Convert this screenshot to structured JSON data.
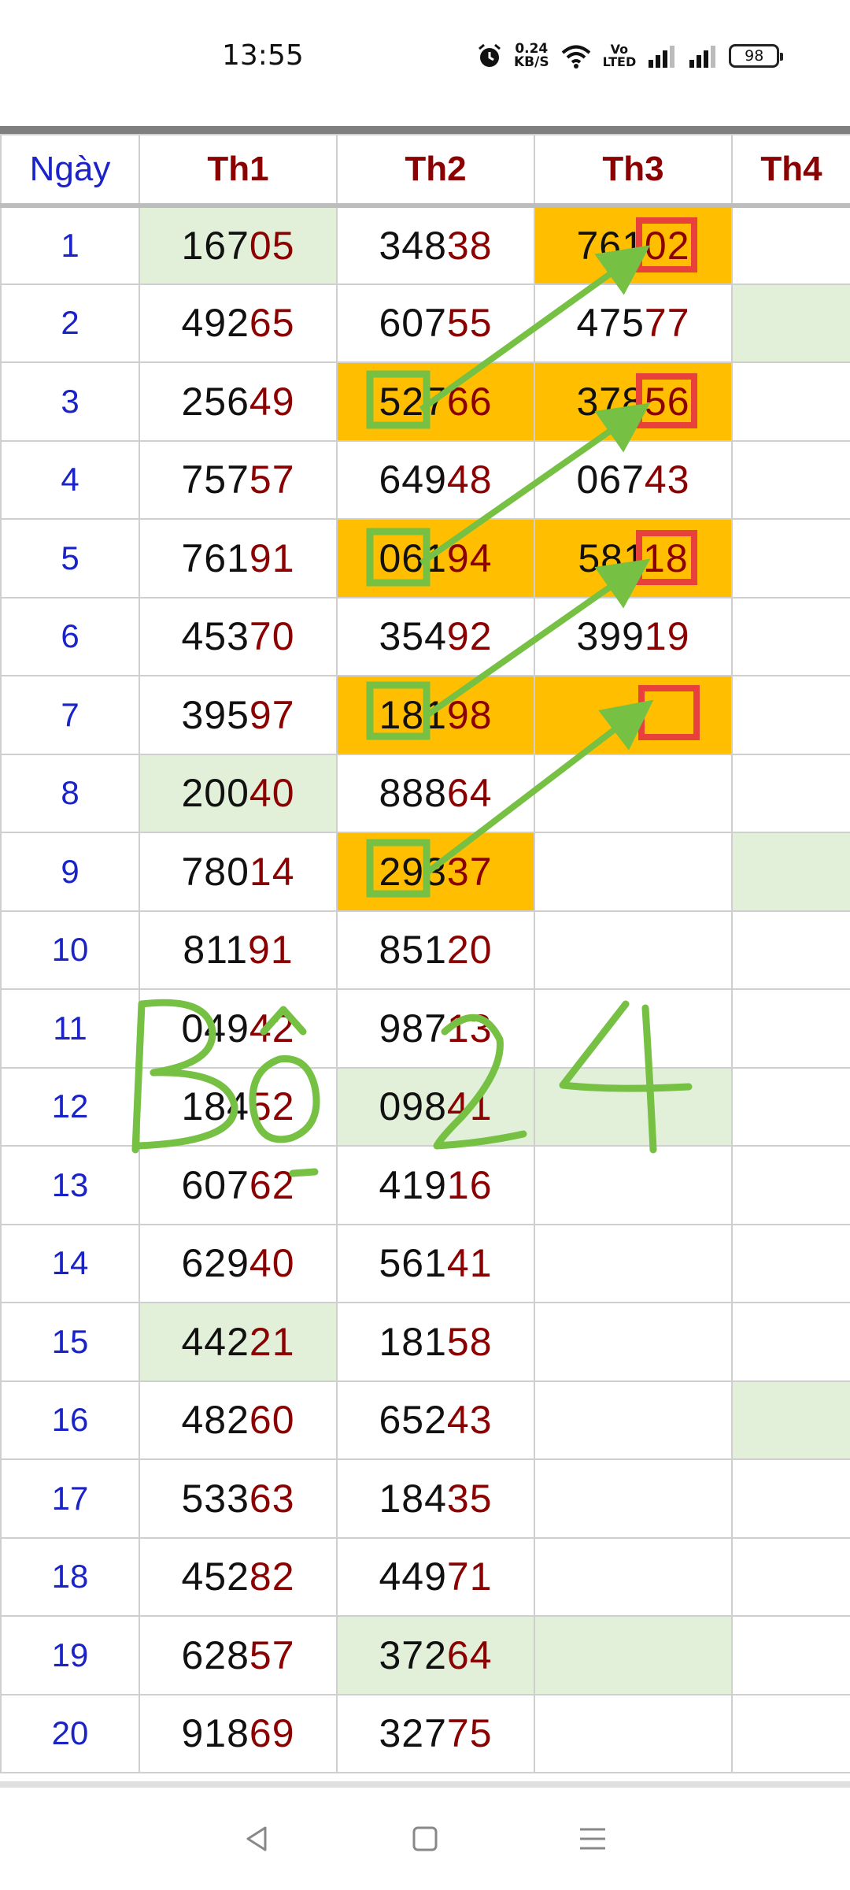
{
  "status_bar": {
    "time": "13:55",
    "speed_value": "0.24",
    "speed_unit": "KB/S",
    "volte_top": "Vo",
    "volte_bottom": "LTED",
    "battery": "98",
    "icons": [
      "alarm-icon",
      "wifi-icon",
      "signal-icon",
      "signal-icon",
      "battery-icon"
    ]
  },
  "table": {
    "headers": [
      "Ngày",
      "Th1",
      "Th2",
      "Th3",
      "Th4"
    ],
    "rows": [
      {
        "day": "1",
        "th1": [
          "167",
          "05"
        ],
        "th2": [
          "348",
          "38"
        ],
        "th3": [
          "761",
          "02"
        ],
        "th4": ""
      },
      {
        "day": "2",
        "th1": [
          "492",
          "65"
        ],
        "th2": [
          "607",
          "55"
        ],
        "th3": [
          "475",
          "77"
        ],
        "th4": ""
      },
      {
        "day": "3",
        "th1": [
          "256",
          "49"
        ],
        "th2": [
          "527",
          "66"
        ],
        "th3": [
          "378",
          "56"
        ],
        "th4": ""
      },
      {
        "day": "4",
        "th1": [
          "757",
          "57"
        ],
        "th2": [
          "649",
          "48"
        ],
        "th3": [
          "067",
          "43"
        ],
        "th4": ""
      },
      {
        "day": "5",
        "th1": [
          "761",
          "91"
        ],
        "th2": [
          "061",
          "94"
        ],
        "th3": [
          "581",
          "18"
        ],
        "th4": ""
      },
      {
        "day": "6",
        "th1": [
          "453",
          "70"
        ],
        "th2": [
          "354",
          "92"
        ],
        "th3": [
          "399",
          "19"
        ],
        "th4": ""
      },
      {
        "day": "7",
        "th1": [
          "395",
          "97"
        ],
        "th2": [
          "181",
          "98"
        ],
        "th3": [
          "",
          ""
        ],
        "th4": ""
      },
      {
        "day": "8",
        "th1": [
          "200",
          "40"
        ],
        "th2": [
          "888",
          "64"
        ],
        "th3": [
          "",
          ""
        ],
        "th4": ""
      },
      {
        "day": "9",
        "th1": [
          "780",
          "14"
        ],
        "th2": [
          "293",
          "37"
        ],
        "th3": [
          "",
          ""
        ],
        "th4": ""
      },
      {
        "day": "10",
        "th1": [
          "811",
          "91"
        ],
        "th2": [
          "851",
          "20"
        ],
        "th3": [
          "",
          ""
        ],
        "th4": ""
      },
      {
        "day": "11",
        "th1": [
          "049",
          "42"
        ],
        "th2": [
          "987",
          "13"
        ],
        "th3": [
          "",
          ""
        ],
        "th4": ""
      },
      {
        "day": "12",
        "th1": [
          "184",
          "52"
        ],
        "th2": [
          "098",
          "41"
        ],
        "th3": [
          "",
          ""
        ],
        "th4": ""
      },
      {
        "day": "13",
        "th1": [
          "607",
          "62"
        ],
        "th2": [
          "419",
          "16"
        ],
        "th3": [
          "",
          ""
        ],
        "th4": ""
      },
      {
        "day": "14",
        "th1": [
          "629",
          "40"
        ],
        "th2": [
          "561",
          "41"
        ],
        "th3": [
          "",
          ""
        ],
        "th4": ""
      },
      {
        "day": "15",
        "th1": [
          "442",
          "21"
        ],
        "th2": [
          "181",
          "58"
        ],
        "th3": [
          "",
          ""
        ],
        "th4": ""
      },
      {
        "day": "16",
        "th1": [
          "482",
          "60"
        ],
        "th2": [
          "652",
          "43"
        ],
        "th3": [
          "",
          ""
        ],
        "th4": ""
      },
      {
        "day": "17",
        "th1": [
          "533",
          "63"
        ],
        "th2": [
          "184",
          "35"
        ],
        "th3": [
          "",
          ""
        ],
        "th4": ""
      },
      {
        "day": "18",
        "th1": [
          "452",
          "82"
        ],
        "th2": [
          "449",
          "71"
        ],
        "th3": [
          "",
          ""
        ],
        "th4": ""
      },
      {
        "day": "19",
        "th1": [
          "628",
          "57"
        ],
        "th2": [
          "372",
          "64"
        ],
        "th3": [
          "",
          ""
        ],
        "th4": ""
      },
      {
        "day": "20",
        "th1": [
          "918",
          "69"
        ],
        "th2": [
          "327",
          "75"
        ],
        "th3": [
          "",
          ""
        ],
        "th4": ""
      }
    ],
    "colors": {
      "highlight_orange": "#ffbf00",
      "highlight_green": "#e2f0d9",
      "day_blue": "#1a23c8",
      "last_digits_red": "#8b0000",
      "annotation_green": "#76c043",
      "annotation_red": "#e8413c"
    }
  },
  "annotation": {
    "handwritten_text": "Bộ 24"
  },
  "nav_bar": {
    "icons": [
      "back-icon",
      "home-icon",
      "menu-icon"
    ]
  }
}
